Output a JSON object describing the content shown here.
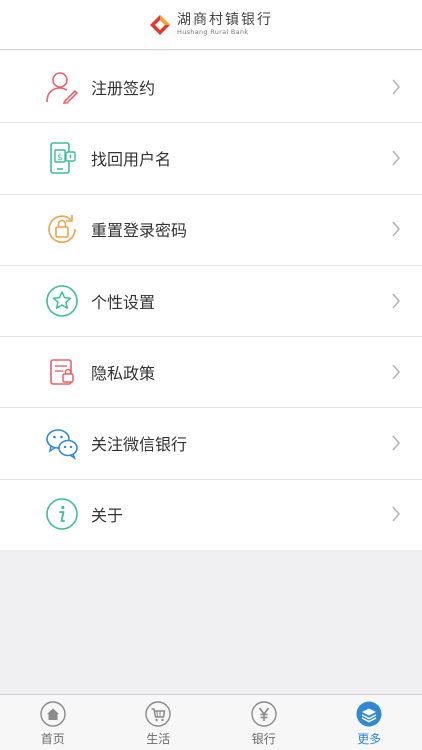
{
  "header": {
    "brand_cn": "湖商村镇银行",
    "brand_en": "Hushang Rural Bank"
  },
  "menu": {
    "items": [
      {
        "label": "注册签约",
        "icon": "register-user-icon"
      },
      {
        "label": "找回用户名",
        "icon": "phone-recover-icon"
      },
      {
        "label": "重置登录密码",
        "icon": "lock-reset-icon"
      },
      {
        "label": "个性设置",
        "icon": "star-icon"
      },
      {
        "label": "隐私政策",
        "icon": "privacy-document-icon"
      },
      {
        "label": "关注微信银行",
        "icon": "wechat-icon"
      },
      {
        "label": "关于",
        "icon": "info-icon"
      }
    ]
  },
  "tabbar": {
    "tabs": [
      {
        "label": "首页",
        "icon": "home-icon"
      },
      {
        "label": "生活",
        "icon": "cart-icon"
      },
      {
        "label": "银行",
        "icon": "yen-icon"
      },
      {
        "label": "更多",
        "icon": "layers-icon",
        "active": true
      }
    ]
  },
  "colors": {
    "active_tab": "#2f8ad3",
    "pink_icon": "#e8626c",
    "teal_icon": "#3cbf9a",
    "orange_icon": "#f0a24a",
    "blue_icon": "#2f8ad3"
  }
}
